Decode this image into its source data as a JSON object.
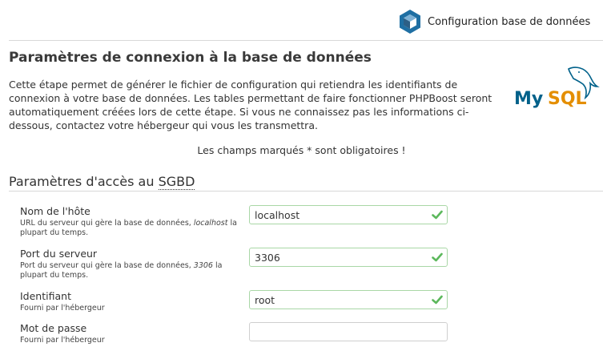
{
  "header": {
    "title": "Configuration base de données"
  },
  "section": {
    "title": "Paramètres de connexion à la base de données",
    "intro": "Cette étape permet de générer le fichier de configuration qui retiendra les identifiants de connexion à votre base de données. Les tables permettant de faire fonctionner PHPBoost seront automatiquement créées lors de cette étape. Si vous ne connaissez pas les informations ci-dessous, contactez votre hébergeur qui vous les transmettra.",
    "logo_text_my": "My",
    "logo_text_sql": "SQL",
    "required_note": "Les champs marqués * sont obligatoires !"
  },
  "access": {
    "title_prefix": "Paramètres d'accès au ",
    "title_abbr": "SGBD",
    "fields": [
      {
        "label": "Nom de l'hôte",
        "desc_before": "URL du serveur qui gère la base de données, ",
        "desc_em": "localhost",
        "desc_after": " la plupart du temps.",
        "value": "localhost",
        "valid": true
      },
      {
        "label": "Port du serveur",
        "desc_before": "Port du serveur qui gère la base de données, ",
        "desc_em": "3306",
        "desc_after": " la plupart du temps.",
        "value": "3306",
        "valid": true
      },
      {
        "label": "Identifiant",
        "desc": "Fourni par l'hébergeur",
        "value": "root",
        "valid": true
      },
      {
        "label": "Mot de passe",
        "desc": "Fourni par l'hébergeur",
        "value": "",
        "valid": false
      }
    ]
  },
  "colors": {
    "valid_border": "#a9d7a6",
    "check": "#5cb85c",
    "mysql_blue": "#00618a",
    "mysql_orange": "#e48e00",
    "logo_blue": "#1f6fa3"
  }
}
